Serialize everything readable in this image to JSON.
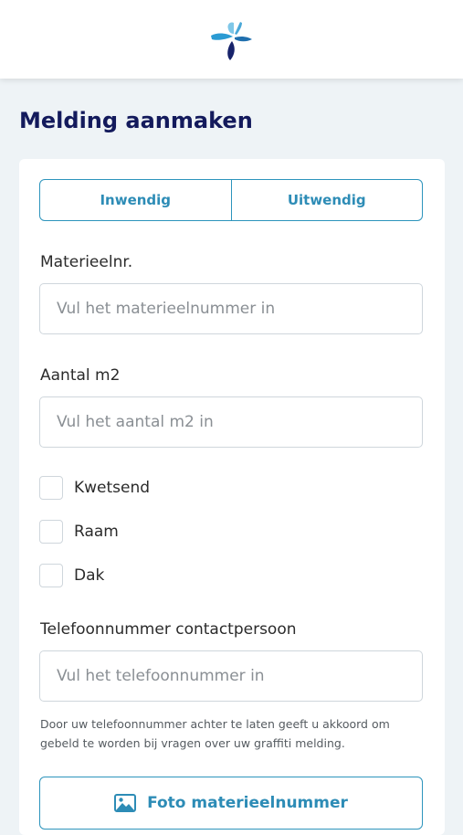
{
  "header": {
    "logo": "brand-logo-icon"
  },
  "page": {
    "title": "Melding aanmaken"
  },
  "tabs": [
    {
      "label": "Inwendig"
    },
    {
      "label": "Uitwendig"
    }
  ],
  "fields": {
    "materieel": {
      "label": "Materieelnr.",
      "value": "",
      "placeholder": "Vul het materieelnummer in"
    },
    "aantal": {
      "label": "Aantal m2",
      "value": "",
      "placeholder": "Vul het aantal m2 in"
    },
    "telefoon": {
      "label": "Telefoonnummer contactpersoon",
      "value": "",
      "placeholder": "Vul het telefoonnummer in"
    }
  },
  "checkboxes": [
    {
      "label": "Kwetsend",
      "checked": false
    },
    {
      "label": "Raam",
      "checked": false
    },
    {
      "label": "Dak",
      "checked": false
    }
  ],
  "help_text": "Door uw telefoonnummer achter te laten geeft u akkoord om gebeld te worden bij vragen over uw graffiti melding.",
  "photo_button": {
    "label": "Foto materieelnummer",
    "icon": "image-icon"
  },
  "colors": {
    "accent": "#2d8cb6",
    "title": "#131a5c",
    "background": "#eef3f6"
  }
}
